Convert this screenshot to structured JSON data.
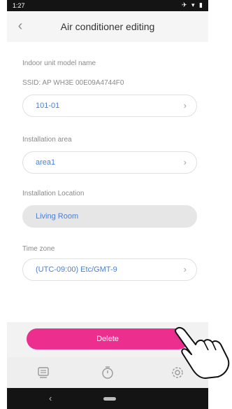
{
  "status_bar": {
    "time": "1:27",
    "icons": "✈ ▾ ▮"
  },
  "header": {
    "title": "Air conditioner editing"
  },
  "form": {
    "model_label": "Indoor unit model name",
    "ssid_text": "SSID: AP WH3E 00E09A4744F0",
    "model_value": "101-01",
    "area_label": "Installation area",
    "area_value": "area1",
    "location_label": "Installation Location",
    "location_value": "Living Room",
    "timezone_label": "Time zone",
    "timezone_value": "(UTC-09:00) Etc/GMT-9"
  },
  "actions": {
    "delete_label": "Delete"
  },
  "tabs": [
    "devices",
    "timer",
    "settings"
  ],
  "colors": {
    "accent": "#ec2f8e",
    "link": "#4a7fd8"
  }
}
